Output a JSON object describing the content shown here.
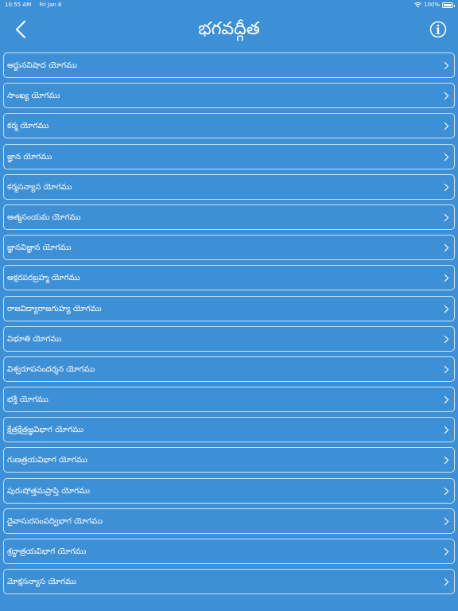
{
  "status_bar": {
    "time": "10:55 AM",
    "date": "Fri Jan 8",
    "battery": "100%",
    "battery_level": 1.0
  },
  "nav": {
    "title": "భగవద్గీత",
    "back_icon": "chevron-left-icon",
    "info_icon": "info-icon"
  },
  "colors": {
    "background": "#3d8fd6",
    "border": "#ffffff",
    "text": "#ffffff"
  },
  "chapters": [
    {
      "label": "అర్జునవిషాద యోగము"
    },
    {
      "label": "సాంఖ్య యోగము"
    },
    {
      "label": "కర్మ యోగము"
    },
    {
      "label": "జ్ఞాన యోగము"
    },
    {
      "label": "కర్మసన్యాస యోగము"
    },
    {
      "label": "ఆత్మసంయమ యోగము"
    },
    {
      "label": "జ్ఞానవిజ్ఞాన యోగము"
    },
    {
      "label": "అక్షరపరబ్రహ్మ యోగము"
    },
    {
      "label": "రాజవిద్యారాజగుహ్య యోగము"
    },
    {
      "label": "విభూతి యోగము"
    },
    {
      "label": "విశ్వరూపసందర్శన యోగము"
    },
    {
      "label": "భక్తి యోగము"
    },
    {
      "label": "క్షేత్రక్షేత్రజ్ఞవిభాగ యోగము"
    },
    {
      "label": "గుణత్రయవిభాగ యోగము"
    },
    {
      "label": "పురుషోత్తమప్రాప్తి యోగము"
    },
    {
      "label": "దైవాసురసంపద్విభాగ యోగము"
    },
    {
      "label": "శ్రద్ధాత్రయవిభాగ యోగము"
    },
    {
      "label": "మోక్షసన్యాస యోగము"
    }
  ]
}
